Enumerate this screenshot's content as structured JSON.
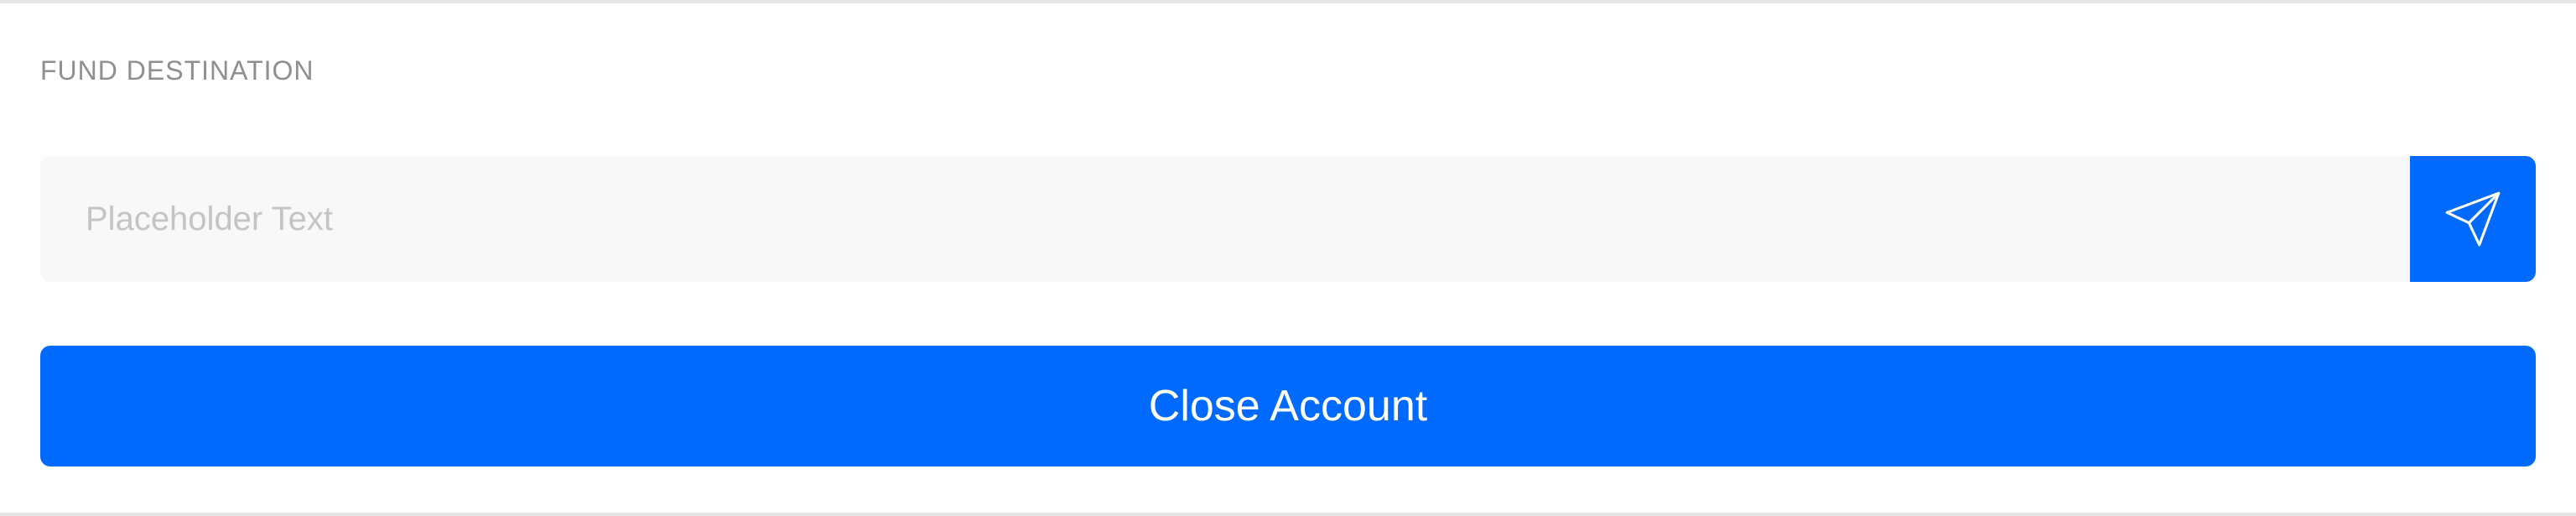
{
  "fund_destination": {
    "label": "FUND DESTINATION",
    "input_placeholder": "Placeholder Text",
    "input_value": "",
    "send_icon": "paper-plane-icon"
  },
  "actions": {
    "close_account_label": "Close Account"
  },
  "colors": {
    "accent": "#006aff",
    "input_background": "#f8f8f8",
    "label": "#8e8e93",
    "placeholder": "#c4c4c4",
    "divider": "#e6e6e6"
  }
}
